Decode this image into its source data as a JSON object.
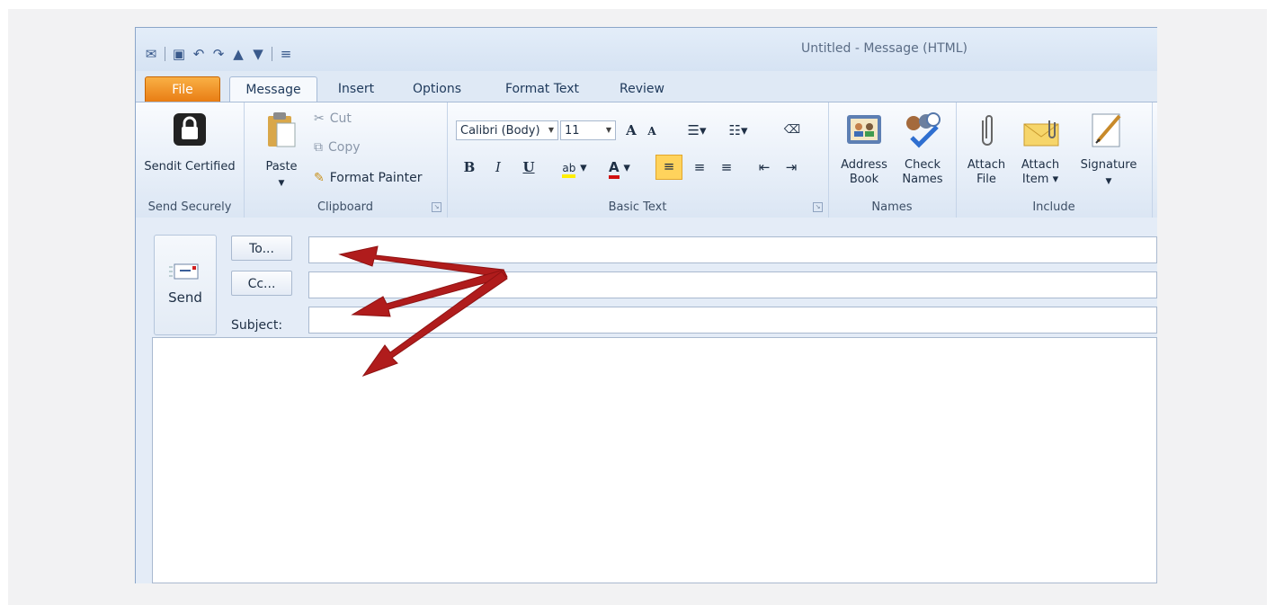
{
  "window": {
    "title": "Untitled - Message (HTML)"
  },
  "quick_access": [
    "app-icon",
    "save-icon",
    "undo-icon",
    "redo-icon",
    "up-arrow-icon",
    "down-arrow-icon",
    "customize-icon"
  ],
  "tabs": [
    {
      "label": "File"
    },
    {
      "label": "Message"
    },
    {
      "label": "Insert"
    },
    {
      "label": "Options"
    },
    {
      "label": "Format Text"
    },
    {
      "label": "Review"
    }
  ],
  "ribbon": {
    "send_securely": {
      "button": "Sendit Certified",
      "group": "Send Securely"
    },
    "clipboard": {
      "paste": "Paste",
      "cut": "Cut",
      "copy": "Copy",
      "format_painter": "Format Painter",
      "group": "Clipboard"
    },
    "basic_text": {
      "font": "Calibri (Body)",
      "size": "11",
      "bold": "B",
      "italic": "I",
      "underline": "U",
      "group": "Basic Text"
    },
    "names": {
      "address_book": "Address Book",
      "check_names": "Check Names",
      "group": "Names"
    },
    "include": {
      "attach_file": "Attach File",
      "attach_item": "Attach Item",
      "signature": "Signature",
      "group": "Include"
    }
  },
  "compose": {
    "send": "Send",
    "to_button": "To...",
    "cc_button": "Cc...",
    "subject_label": "Subject:",
    "to_value": "",
    "cc_value": "",
    "subject_value": ""
  },
  "colors": {
    "file_tab": "#e87b12",
    "annotation_arrow": "#b01c1c"
  }
}
